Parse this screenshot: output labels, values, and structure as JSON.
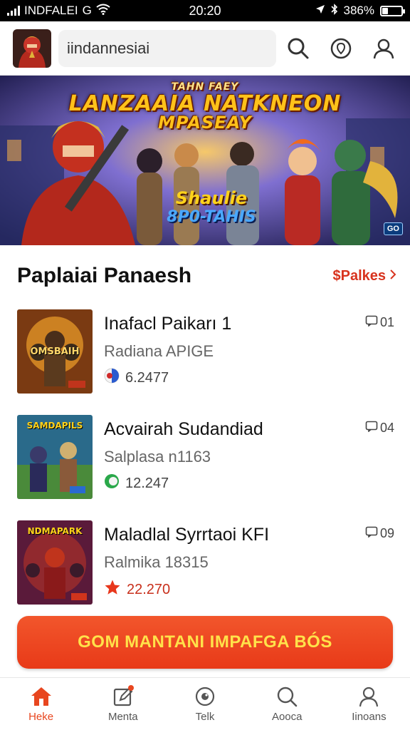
{
  "status_bar": {
    "carrier": "INDFALEI",
    "network": "G",
    "time": "20:20",
    "battery": "386%"
  },
  "header": {
    "search_text": "iindannesiai",
    "icons": [
      "app-avatar",
      "search-icon",
      "location-pin-icon",
      "profile-icon"
    ]
  },
  "banner": {
    "kicker": "TAHN FAEY",
    "title_line1": "LANZAAIA NATKNEON",
    "title_line2": "MPASEAY",
    "logo_line1": "Shaulie",
    "logo_line2": "8P0-TAHIS",
    "badge": "GO"
  },
  "section": {
    "title": "Paplaiai Panaesh",
    "link": "$Palkes"
  },
  "games": [
    {
      "name": "Inafacl Paikarı 1",
      "sub": "Radiana APIGE",
      "rating": "6.2477",
      "count": "01",
      "rating_icon": "flag-badge-icon",
      "thumb_text": "OMSBAIH"
    },
    {
      "name": "Acvairah Sudandiad",
      "sub": "Salplasa n1163",
      "rating": "12.247",
      "count": "04",
      "rating_icon": "green-badge-icon",
      "thumb_text": "SAMDAPILS"
    },
    {
      "name": "Maladlal Syrrtaoi KFI",
      "sub": "Ralmika 18315",
      "rating": "22.270",
      "count": "09",
      "rating_icon": "star-icon",
      "thumb_text": "NDMAPARK"
    }
  ],
  "cta": {
    "label": "GOM MANTANI IMPAFGA BÓS"
  },
  "bottom_nav": [
    {
      "label": "Heke",
      "icon": "home-icon",
      "active": true
    },
    {
      "label": "Menta",
      "icon": "edit-icon",
      "active": false
    },
    {
      "label": "Telk",
      "icon": "eye-icon",
      "active": false
    },
    {
      "label": "Aooca",
      "icon": "search-icon",
      "active": false
    },
    {
      "label": "Iinoans",
      "icon": "profile-icon",
      "active": false
    }
  ],
  "colors": {
    "accent": "#e8461f",
    "cta_text": "#ffe24a",
    "status_bar": "#000000"
  }
}
